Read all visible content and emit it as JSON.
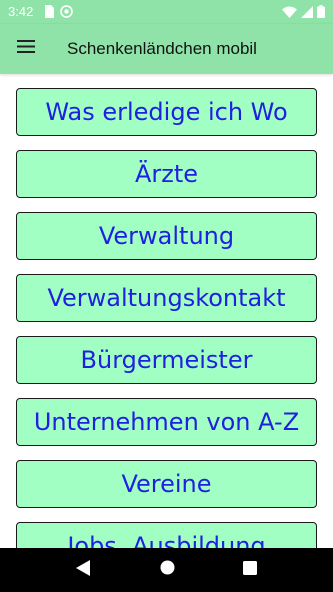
{
  "status_bar": {
    "time": "3:42",
    "left_icons": [
      "sim-card-icon",
      "at-sign-icon"
    ],
    "right_icons": [
      "wifi-icon",
      "cell-signal-icon",
      "battery-icon"
    ]
  },
  "app_bar": {
    "menu_icon": "hamburger-menu-icon",
    "title": "Schenkenländchen mobil"
  },
  "menu": {
    "items": [
      {
        "label": "Was erledige ich Wo"
      },
      {
        "label": "Ärzte"
      },
      {
        "label": "Verwaltung"
      },
      {
        "label": "Verwaltungskontakt"
      },
      {
        "label": "Bürgermeister"
      },
      {
        "label": "Unternehmen von A-Z"
      },
      {
        "label": "Vereine"
      },
      {
        "label": "Jobs, Ausbildung"
      }
    ]
  },
  "nav_bar": {
    "icons": [
      "back-triangle-icon",
      "home-circle-icon",
      "recents-square-icon"
    ]
  },
  "colors": {
    "app_bar_bg": "#8fe3a8",
    "button_bg": "#a2ffc4",
    "button_text": "#2020e0",
    "button_border": "#1a1a1a",
    "nav_bar_bg": "#000000"
  }
}
